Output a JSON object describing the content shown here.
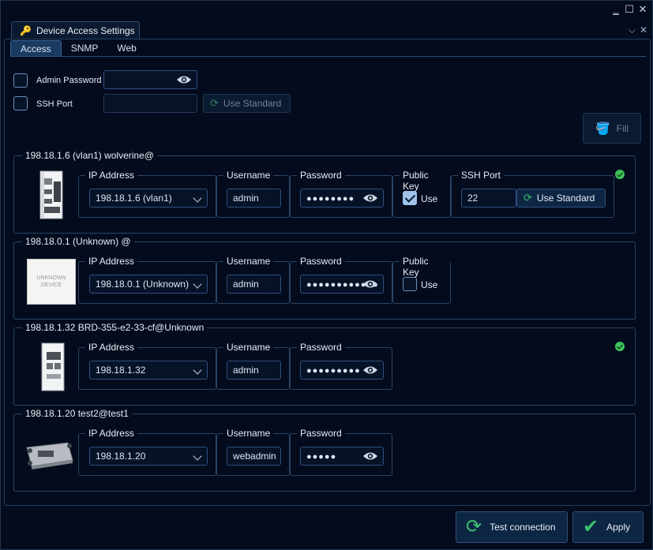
{
  "tab": {
    "title": "Device Access Settings",
    "icon": "key-icon"
  },
  "subtabs": [
    "Access",
    "SNMP",
    "Web"
  ],
  "global": {
    "admin_password_label": "Admin Password",
    "ssh_port_label": "SSH Port",
    "use_standard_label": "Use Standard",
    "fill_label": "Fill"
  },
  "labels": {
    "ip_address": "IP Address",
    "username": "Username",
    "password": "Password",
    "public_key": "Public Key",
    "ssh_port": "SSH Port",
    "use": "Use",
    "use_standard": "Use Standard"
  },
  "devices": [
    {
      "title": "198.18.1.6 (vlan1) wolverine@",
      "ip": "198.18.1.6 (vlan1)",
      "username": "admin",
      "password_mask": "●●●●●●●●",
      "public_key_checked": true,
      "ssh_port": "22",
      "status": "ok"
    },
    {
      "title": "198.18.0.1 (Unknown) @",
      "ip": "198.18.0.1 (Unknown)",
      "username": "admin",
      "password_mask": "●●●●●●●●●●●●",
      "public_key_checked": false,
      "image_text": "UNKNOWN DEVICE"
    },
    {
      "title": "198.18.1.32 BRD-355-e2-33-cf@Unknown",
      "ip": "198.18.1.32",
      "username": "admin",
      "password_mask": "●●●●●●●●●",
      "status": "ok"
    },
    {
      "title": "198.18.1.20 test2@test1",
      "ip": "198.18.1.20",
      "username": "webadmin",
      "password_mask": "●●●●●"
    }
  ],
  "footer": {
    "test_connection_label": "Test connection",
    "apply_label": "Apply"
  },
  "colors": {
    "background": "#030b1c",
    "accent": "#1b3a60",
    "ok": "#3ec15a",
    "border": "#2a4466"
  }
}
